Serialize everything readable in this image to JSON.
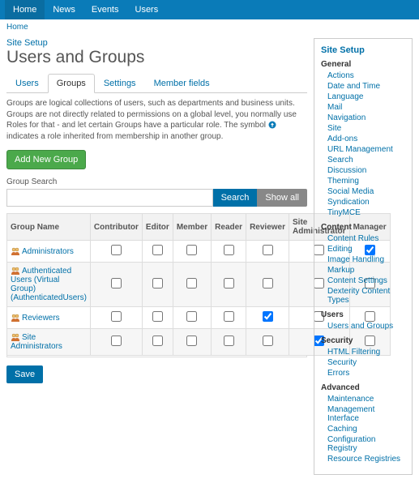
{
  "nav": {
    "items": [
      "Home",
      "News",
      "Events",
      "Users"
    ],
    "active": 0
  },
  "breadcrumb": "Home",
  "site_setup_link": "Site Setup",
  "page_title": "Users and Groups",
  "tabs": {
    "items": [
      "Users",
      "Groups",
      "Settings",
      "Member fields"
    ],
    "active": 1
  },
  "description": {
    "part1": "Groups are logical collections of users, such as departments and business units. Groups are not directly related to permissions on a global level, you normally use Roles for that - and let certain Groups have a particular role. The symbol",
    "part2": "indicates a role inherited from membership in another group."
  },
  "add_group_btn": "Add New Group",
  "search": {
    "label": "Group Search",
    "value": "",
    "search_btn": "Search",
    "showall_btn": "Show all"
  },
  "table": {
    "headers": [
      "Group Name",
      "Contributor",
      "Editor",
      "Member",
      "Reader",
      "Reviewer",
      "Site Administrator",
      "Manager"
    ],
    "rows": [
      {
        "name": "Administrators",
        "checks": [
          false,
          false,
          false,
          false,
          false,
          false,
          true
        ]
      },
      {
        "name": "Authenticated Users (Virtual Group) (AuthenticatedUsers)",
        "checks": [
          false,
          false,
          false,
          false,
          false,
          false,
          false
        ]
      },
      {
        "name": "Reviewers",
        "checks": [
          false,
          false,
          false,
          false,
          true,
          false,
          false
        ]
      },
      {
        "name": "Site Administrators",
        "checks": [
          false,
          false,
          false,
          false,
          false,
          true,
          false
        ]
      }
    ]
  },
  "save_btn": "Save",
  "sidebar": {
    "title": "Site Setup",
    "sections": [
      {
        "name": "General",
        "items": [
          "Actions",
          "Date and Time",
          "Language",
          "Mail",
          "Navigation",
          "Site",
          "Add-ons",
          "URL Management",
          "Search",
          "Discussion",
          "Theming",
          "Social Media",
          "Syndication",
          "TinyMCE"
        ]
      },
      {
        "name": "Content",
        "items": [
          "Content Rules",
          "Editing",
          "Image Handling",
          "Markup",
          "Content Settings",
          "Dexterity Content Types"
        ]
      },
      {
        "name": "Users",
        "items": [
          "Users and Groups"
        ]
      },
      {
        "name": "Security",
        "items": [
          "HTML Filtering",
          "Security",
          "Errors"
        ]
      },
      {
        "name": "Advanced",
        "items": [
          "Maintenance",
          "Management Interface",
          "Caching",
          "Configuration Registry",
          "Resource Registries"
        ]
      }
    ]
  }
}
